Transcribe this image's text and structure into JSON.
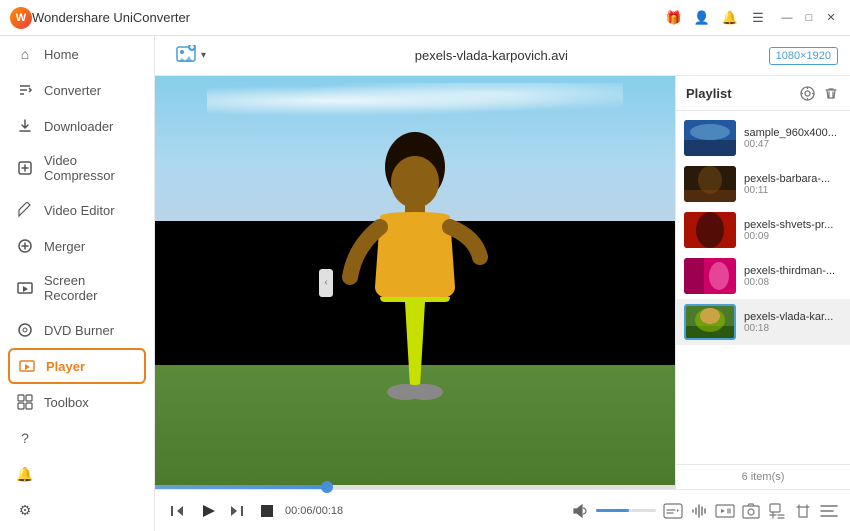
{
  "titlebar": {
    "app_name": "Wondershare UniConverter",
    "icons": {
      "gift": "🎁",
      "user": "👤",
      "bell": "🔔"
    },
    "window_controls": {
      "minimize": "—",
      "maximize": "□",
      "close": "✕"
    }
  },
  "sidebar": {
    "items": [
      {
        "id": "home",
        "label": "Home",
        "icon": "⌂"
      },
      {
        "id": "converter",
        "label": "Converter",
        "icon": "↔"
      },
      {
        "id": "downloader",
        "label": "Downloader",
        "icon": "↓"
      },
      {
        "id": "video-compressor",
        "label": "Video Compressor",
        "icon": "⊡"
      },
      {
        "id": "video-editor",
        "label": "Video Editor",
        "icon": "✂"
      },
      {
        "id": "merger",
        "label": "Merger",
        "icon": "⊕"
      },
      {
        "id": "screen-recorder",
        "label": "Screen Recorder",
        "icon": "▣"
      },
      {
        "id": "dvd-burner",
        "label": "DVD Burner",
        "icon": "◉"
      },
      {
        "id": "player",
        "label": "Player",
        "icon": "▶"
      },
      {
        "id": "toolbox",
        "label": "Toolbox",
        "icon": "⊞"
      }
    ],
    "bottom_items": [
      {
        "id": "help",
        "icon": "?"
      },
      {
        "id": "notification",
        "icon": "🔔"
      },
      {
        "id": "settings",
        "icon": "⚙"
      }
    ]
  },
  "toolbar": {
    "add_icon": "+",
    "add_dropdown": "▾",
    "filename": "pexels-vlada-karpovich.avi",
    "resolution": "1080×1920"
  },
  "playlist": {
    "title": "Playlist",
    "settings_icon": "⚙",
    "delete_icon": "🗑",
    "items": [
      {
        "id": 1,
        "name": "sample_960x400...",
        "duration": "00:47",
        "thumb_class": "thumb-blue"
      },
      {
        "id": 2,
        "name": "pexels-barbara-...",
        "duration": "00:11",
        "thumb_class": "thumb-dark"
      },
      {
        "id": 3,
        "name": "pexels-shvets-pr...",
        "duration": "00:09",
        "thumb_class": "thumb-red"
      },
      {
        "id": 4,
        "name": "pexels-thirdman-...",
        "duration": "00:08",
        "thumb_class": "thumb-magenta"
      },
      {
        "id": 5,
        "name": "pexels-vlada-kar...",
        "duration": "00:18",
        "thumb_class": "thumb-green-yellow",
        "active": true
      }
    ],
    "count": "6 item(s)"
  },
  "controls": {
    "rewind": "⏮",
    "play": "▶",
    "forward_frame": "⏭",
    "stop": "⏹",
    "time_current": "00:06",
    "time_total": "00:18",
    "volume_icon": "🔊",
    "progress_percent": 33,
    "volume_percent": 55,
    "subtitles": "CC",
    "aspect": "⬜",
    "audio": "♪",
    "screenshot": "📷",
    "zoom_in": "⊕",
    "zoom_out": "⊖",
    "settings_icon": "⚙",
    "playlist_icon": "☰"
  },
  "colors": {
    "accent_blue": "#4a9fd4",
    "accent_orange": "#e8821e",
    "sidebar_bg": "#ffffff",
    "content_bg": "#f5f5f5",
    "active_item_border": "#e8821e",
    "progress_color": "#4a8fd8"
  }
}
